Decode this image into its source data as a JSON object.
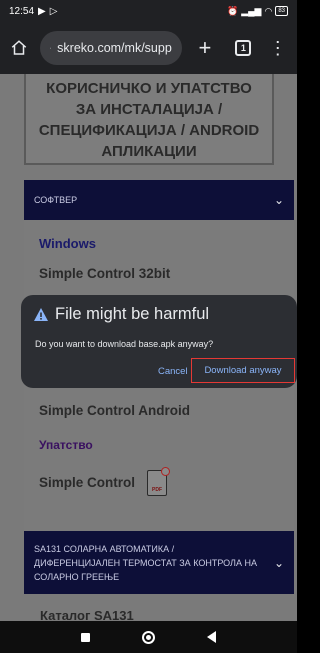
{
  "status_bar": {
    "time": "12:54",
    "battery": "83"
  },
  "browser": {
    "url": "skreko.com/mk/supp",
    "tab_count": "1"
  },
  "page": {
    "heading": "КОРИСНИЧКО И УПАТСТВО ЗА ИНСТАЛАЦИЈА / СПЕЦИФИКАЦИЈА / ANDROID АПЛИКАЦИИ",
    "section1_title": "СОФТВЕР",
    "windows_label": "Windows",
    "item1": "Simple Control 32bit",
    "item_android": "Simple Control Android",
    "instructions_label": "Упатство",
    "item_manual": "Simple Control",
    "section2_title": "SA131 СОЛАРНА АВТОМАТИКА / ДИФЕРЕНЦИЈАЛЕН ТЕРМОСТАТ ЗА КОНТРОЛА НА СОЛАРНО ГРЕЕЊЕ",
    "partial_item": "Каталог SA131"
  },
  "dialog": {
    "title": "File might be harmful",
    "message": "Do you want to download base.apk anyway?",
    "cancel_label": "Cancel",
    "download_label": "Download anyway"
  },
  "colors": {
    "dialog_bg": "#2c2e33",
    "link_blue": "#8ab4f8",
    "highlight_red": "#e53935",
    "section_navy": "#0d0f38"
  }
}
